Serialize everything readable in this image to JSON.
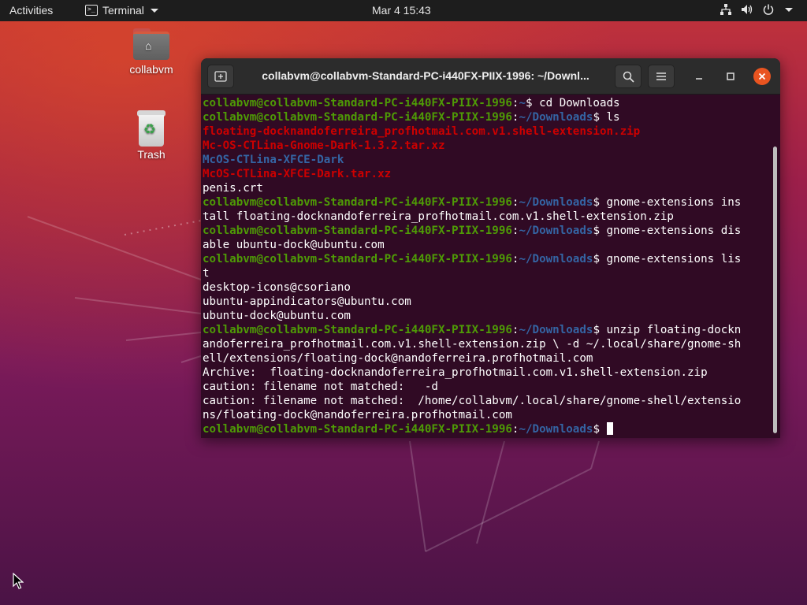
{
  "topbar": {
    "activities": "Activities",
    "app_name": "Terminal",
    "clock": "Mar 4  15:43"
  },
  "desktop": {
    "home_label": "collabvm",
    "trash_label": "Trash"
  },
  "terminal": {
    "title": "collabvm@collabvm-Standard-PC-i440FX-PIIX-1996: ~/Downl...",
    "prompt_user": "collabvm@collabvm-Standard-PC-i440FX-PIIX-1996",
    "lines": {
      "l01_path": "~",
      "l01_cmd": "$ cd Downloads",
      "l02_path": "~/Downloads",
      "l02_cmd": "$ ls",
      "l03": "floating-docknandoferreira_profhotmail.com.v1.shell-extension.zip",
      "l04": "Mc-OS-CTLina-Gnome-Dark-1.3.2.tar.xz",
      "l05": "McOS-CTLina-XFCE-Dark",
      "l06": "McOS-CTLina-XFCE-Dark.tar.xz",
      "l07": "penis.crt",
      "l08_path": "~/Downloads",
      "l08_cmd": "$ gnome-extensions ins",
      "l09": "tall floating-docknandoferreira_profhotmail.com.v1.shell-extension.zip",
      "l10_path": "~/Downloads",
      "l10_cmd": "$ gnome-extensions dis",
      "l11": "able ubuntu-dock@ubuntu.com",
      "l12_path": "~/Downloads",
      "l12_cmd": "$ gnome-extensions lis",
      "l13": "t",
      "l14": "desktop-icons@csoriano",
      "l15": "ubuntu-appindicators@ubuntu.com",
      "l16": "ubuntu-dock@ubuntu.com",
      "l17_path": "~/Downloads",
      "l17_cmd": "$ unzip floating-dockn",
      "l18": "andoferreira_profhotmail.com.v1.shell-extension.zip \\ -d ~/.local/share/gnome-sh",
      "l19": "ell/extensions/floating-dock@nandoferreira.profhotmail.com",
      "l20": "Archive:  floating-docknandoferreira_profhotmail.com.v1.shell-extension.zip",
      "l21": "caution: filename not matched:   -d",
      "l22": "caution: filename not matched:  /home/collabvm/.local/share/gnome-shell/extensio",
      "l23": "ns/floating-dock@nandoferreira.profhotmail.com",
      "l24_path": "~/Downloads",
      "l24_cmd": "$ "
    }
  },
  "icons": {
    "network": "network-icon",
    "volume": "volume-icon",
    "power": "power-icon",
    "search": "search-icon",
    "hamburger": "hamburger-menu-icon",
    "new_tab": "new-tab-icon",
    "minimize": "minimize-icon",
    "maximize": "maximize-icon",
    "close": "close-icon"
  },
  "colors": {
    "terminal_bg": "#300a24",
    "prompt_user": "#4e9a06",
    "prompt_path": "#3465a4",
    "archive_red": "#cc0000",
    "close_orange": "#e95420"
  }
}
